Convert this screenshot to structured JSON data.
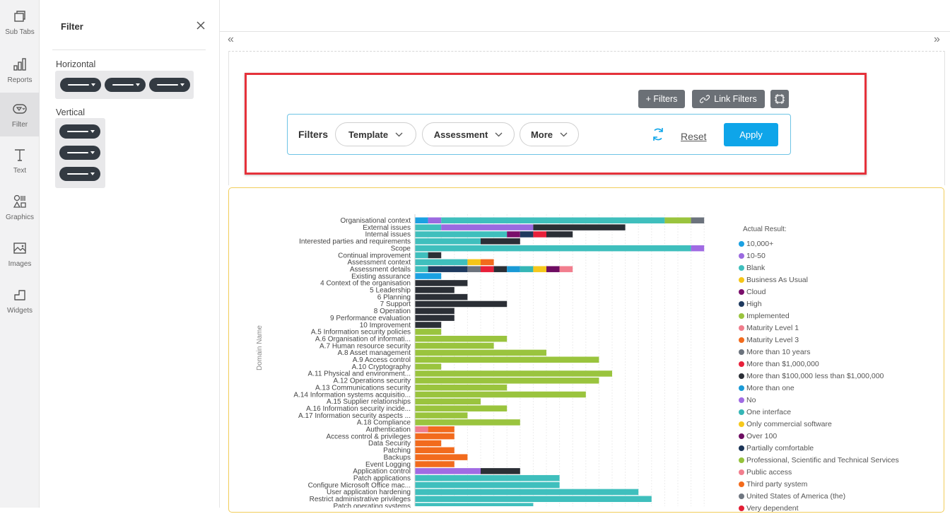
{
  "rail": {
    "items": [
      {
        "label": "Sub Tabs",
        "icon": "sub-tabs-icon"
      },
      {
        "label": "Reports",
        "icon": "bar-chart-icon"
      },
      {
        "label": "Filter",
        "icon": "filter-icon"
      },
      {
        "label": "Text",
        "icon": "text-icon"
      },
      {
        "label": "Graphics",
        "icon": "shapes-icon"
      },
      {
        "label": "Images",
        "icon": "image-icon"
      },
      {
        "label": "Widgets",
        "icon": "widget-icon"
      }
    ],
    "active": "Filter"
  },
  "panel": {
    "title": "Filter",
    "horizontal_label": "Horizontal",
    "vertical_label": "Vertical"
  },
  "toolbar": {
    "add_filters": "+ Filters",
    "link_filters": "Link Filters"
  },
  "filter_bar": {
    "label": "Filters",
    "pills": [
      "Template",
      "Assessment",
      "More"
    ],
    "reset": "Reset",
    "apply": "Apply"
  },
  "colors": {
    "accent": "#0ea5e9",
    "highlight_border": "#e5323b",
    "card_border": "#f1cd5a"
  },
  "chart_data": {
    "type": "bar",
    "orientation": "horizontal",
    "stacked": true,
    "ylabel": "Domain Name",
    "legend_title": "Actual Result:",
    "legend_placement": "right",
    "grid": true,
    "legend": [
      {
        "name": "10,000+",
        "color": "#1ba1e2"
      },
      {
        "name": "10-50",
        "color": "#9b6ae0"
      },
      {
        "name": "Blank",
        "color": "#3fbfbd"
      },
      {
        "name": "Business As Usual",
        "color": "#f5c518"
      },
      {
        "name": "Cloud",
        "color": "#7a0f6b"
      },
      {
        "name": "High",
        "color": "#1f3a5f"
      },
      {
        "name": "Implemented",
        "color": "#9ac43e"
      },
      {
        "name": "Maturity Level 1",
        "color": "#f07d8c"
      },
      {
        "name": "Maturity Level 3",
        "color": "#f26b1d"
      },
      {
        "name": "More than 10 years",
        "color": "#6c737d"
      },
      {
        "name": "More than $1,000,000",
        "color": "#e8203a"
      },
      {
        "name": "More than $100,000 less than $1,000,000",
        "color": "#2b2f36"
      },
      {
        "name": "More than one",
        "color": "#1a9ad6"
      },
      {
        "name": "No",
        "color": "#a06be3"
      },
      {
        "name": "One interface",
        "color": "#35b6b6"
      },
      {
        "name": "Only commercial software",
        "color": "#f6c81c"
      },
      {
        "name": "Over 100",
        "color": "#6e0d62"
      },
      {
        "name": "Partially comfortable",
        "color": "#1c3557"
      },
      {
        "name": "Professional, Scientific and Technical Services",
        "color": "#95c23b"
      },
      {
        "name": "Public access",
        "color": "#f27e8e"
      },
      {
        "name": "Third party system",
        "color": "#f36a1b"
      },
      {
        "name": "United States of America (the)",
        "color": "#707781"
      },
      {
        "name": "Very dependent",
        "color": "#e31f36"
      }
    ],
    "categories": [
      "Organisational context",
      "External issues",
      "Internal issues",
      "Interested parties and requirements",
      "Scope",
      "Continual improvement",
      "Assessment context",
      "Assessment details",
      "Existing assurance",
      "4 Context of the organisation",
      "5 Leadership",
      "6 Planning",
      "7 Support",
      "8 Operation",
      "9 Performance evaluation",
      "10 Improvement",
      "A.5 Information security policies",
      "A.6 Organisation of informati...",
      "A.7 Human resource security",
      "A.8 Asset management",
      "A.9 Access control",
      "A.10 Cryptography",
      "A.11 Physical and environment...",
      "A.12 Operations security",
      "A.13 Communications security",
      "A.14 Information systems acquisitio...",
      "A.15 Supplier relationships",
      "A.16 Information security incide...",
      "A.17 Information security aspects ...",
      "A.18 Compliance",
      "Authentication",
      "Access control & privileges",
      "Data Security",
      "Patching",
      "Backups",
      "Event Logging",
      "Application control",
      "Patch applications",
      "Configure Microsoft Office mac...",
      "User application hardening",
      "Restrict administrative privileges",
      "Patch operating systems"
    ],
    "bars": [
      [
        [
          1,
          "#1ba1e2"
        ],
        [
          1,
          "#9b6ae0"
        ],
        [
          17,
          "#3fbfbd"
        ],
        [
          2,
          "#9ac43e"
        ],
        [
          1,
          "#6c737d"
        ]
      ],
      [
        [
          2,
          "#3fbfbd"
        ],
        [
          7,
          "#9b6ae0"
        ],
        [
          7,
          "#2b2f36"
        ]
      ],
      [
        [
          7,
          "#3fbfbd"
        ],
        [
          1,
          "#7a0f6b"
        ],
        [
          1,
          "#1f3a5f"
        ],
        [
          1,
          "#e8203a"
        ],
        [
          2,
          "#2b2f36"
        ]
      ],
      [
        [
          5,
          "#3fbfbd"
        ],
        [
          3,
          "#2b2f36"
        ]
      ],
      [
        [
          21,
          "#3fbfbd"
        ],
        [
          1,
          "#a06be3"
        ]
      ],
      [
        [
          1,
          "#3fbfbd"
        ],
        [
          1,
          "#2b2f36"
        ]
      ],
      [
        [
          4,
          "#3fbfbd"
        ],
        [
          1,
          "#f5c518"
        ],
        [
          1,
          "#f26b1d"
        ]
      ],
      [
        [
          1,
          "#3fbfbd"
        ],
        [
          3,
          "#1f3a5f"
        ],
        [
          1,
          "#6c737d"
        ],
        [
          1,
          "#e8203a"
        ],
        [
          1,
          "#2b2f36"
        ],
        [
          1,
          "#1a9ad6"
        ],
        [
          1,
          "#35b6b6"
        ],
        [
          1,
          "#f6c81c"
        ],
        [
          1,
          "#6e0d62"
        ],
        [
          1,
          "#f27e8e"
        ]
      ],
      [
        [
          2,
          "#1ba1e2"
        ]
      ],
      [
        [
          4,
          "#2b2f36"
        ]
      ],
      [
        [
          3,
          "#2b2f36"
        ]
      ],
      [
        [
          4,
          "#2b2f36"
        ]
      ],
      [
        [
          7,
          "#2b2f36"
        ]
      ],
      [
        [
          3,
          "#2b2f36"
        ]
      ],
      [
        [
          3,
          "#2b2f36"
        ]
      ],
      [
        [
          2,
          "#2b2f36"
        ]
      ],
      [
        [
          2,
          "#9ac43e"
        ]
      ],
      [
        [
          7,
          "#9ac43e"
        ]
      ],
      [
        [
          6,
          "#9ac43e"
        ]
      ],
      [
        [
          10,
          "#9ac43e"
        ]
      ],
      [
        [
          14,
          "#9ac43e"
        ]
      ],
      [
        [
          2,
          "#9ac43e"
        ]
      ],
      [
        [
          15,
          "#9ac43e"
        ]
      ],
      [
        [
          14,
          "#9ac43e"
        ]
      ],
      [
        [
          7,
          "#9ac43e"
        ]
      ],
      [
        [
          13,
          "#9ac43e"
        ]
      ],
      [
        [
          5,
          "#9ac43e"
        ]
      ],
      [
        [
          7,
          "#9ac43e"
        ]
      ],
      [
        [
          4,
          "#9ac43e"
        ]
      ],
      [
        [
          8,
          "#9ac43e"
        ]
      ],
      [
        [
          1,
          "#f07d8c"
        ],
        [
          2,
          "#f26b1d"
        ]
      ],
      [
        [
          3,
          "#f26b1d"
        ]
      ],
      [
        [
          2,
          "#f26b1d"
        ]
      ],
      [
        [
          3,
          "#f26b1d"
        ]
      ],
      [
        [
          4,
          "#f26b1d"
        ]
      ],
      [
        [
          3,
          "#f26b1d"
        ]
      ],
      [
        [
          5,
          "#a06be3"
        ],
        [
          3,
          "#2b2f36"
        ]
      ],
      [
        [
          11,
          "#3fbfbd"
        ]
      ],
      [
        [
          11,
          "#3fbfbd"
        ]
      ],
      [
        [
          17,
          "#3fbfbd"
        ]
      ],
      [
        [
          18,
          "#3fbfbd"
        ]
      ],
      [
        [
          9,
          "#3fbfbd"
        ]
      ]
    ]
  }
}
